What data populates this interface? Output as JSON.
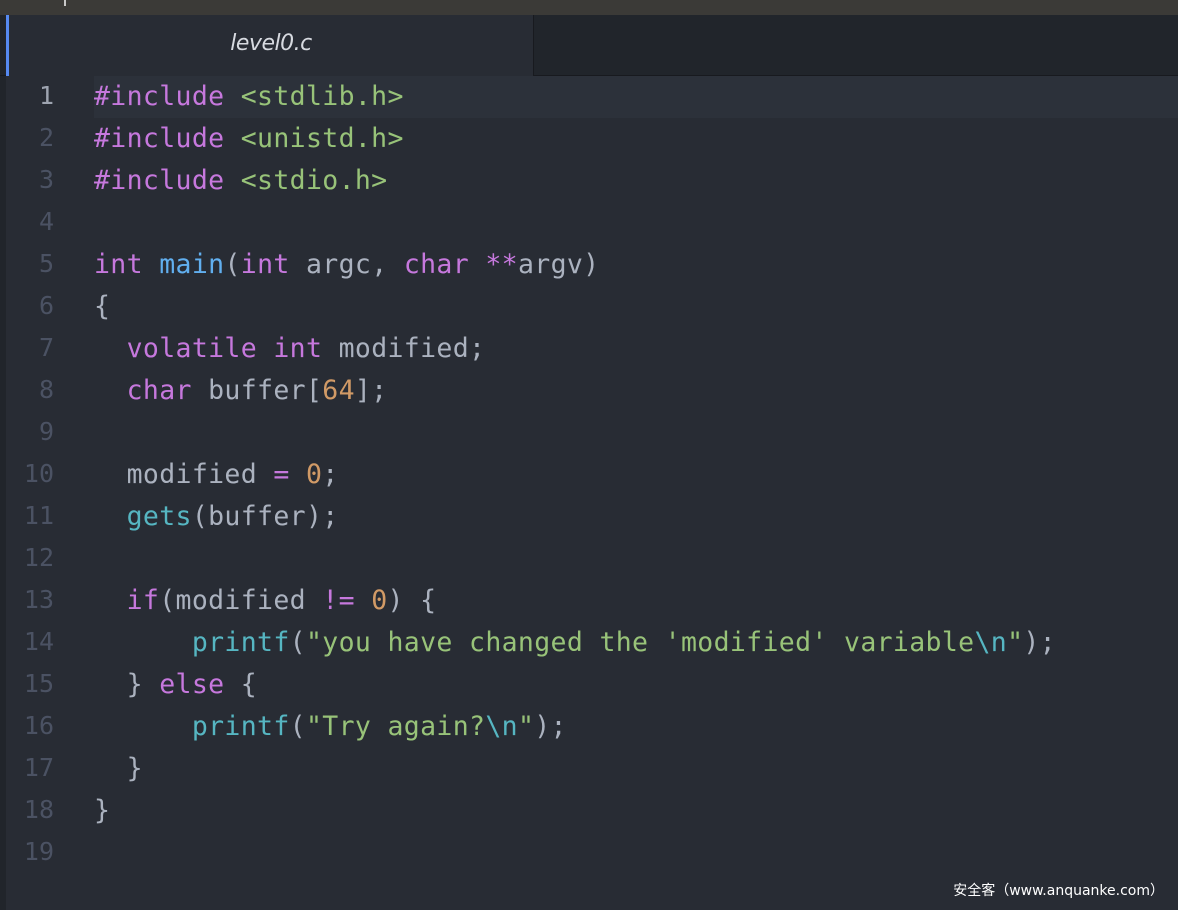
{
  "tab": {
    "title": "level0.c"
  },
  "lines": [
    {
      "n": "1",
      "tokens": [
        [
          "t-kw",
          "#include"
        ],
        [
          "t-plain",
          " "
        ],
        [
          "t-str",
          "<stdlib.h>"
        ]
      ]
    },
    {
      "n": "2",
      "tokens": [
        [
          "t-kw",
          "#include"
        ],
        [
          "t-plain",
          " "
        ],
        [
          "t-str",
          "<unistd.h>"
        ]
      ]
    },
    {
      "n": "3",
      "tokens": [
        [
          "t-kw",
          "#include"
        ],
        [
          "t-plain",
          " "
        ],
        [
          "t-str",
          "<stdio.h>"
        ]
      ]
    },
    {
      "n": "4",
      "tokens": []
    },
    {
      "n": "5",
      "tokens": [
        [
          "t-kw",
          "int"
        ],
        [
          "t-plain",
          " "
        ],
        [
          "t-fn",
          "main"
        ],
        [
          "t-plain",
          "("
        ],
        [
          "t-kw",
          "int"
        ],
        [
          "t-plain",
          " argc, "
        ],
        [
          "t-kw",
          "char"
        ],
        [
          "t-plain",
          " "
        ],
        [
          "t-op",
          "**"
        ],
        [
          "t-plain",
          "argv)"
        ]
      ]
    },
    {
      "n": "6",
      "tokens": [
        [
          "t-plain",
          "{"
        ]
      ]
    },
    {
      "n": "7",
      "tokens": [
        [
          "t-plain",
          "  "
        ],
        [
          "t-kw",
          "volatile"
        ],
        [
          "t-plain",
          " "
        ],
        [
          "t-kw",
          "int"
        ],
        [
          "t-plain",
          " modified;"
        ]
      ]
    },
    {
      "n": "8",
      "tokens": [
        [
          "t-plain",
          "  "
        ],
        [
          "t-kw",
          "char"
        ],
        [
          "t-plain",
          " buffer["
        ],
        [
          "t-num",
          "64"
        ],
        [
          "t-plain",
          "];"
        ]
      ]
    },
    {
      "n": "9",
      "tokens": []
    },
    {
      "n": "10",
      "tokens": [
        [
          "t-plain",
          "  modified "
        ],
        [
          "t-op",
          "="
        ],
        [
          "t-plain",
          " "
        ],
        [
          "t-num",
          "0"
        ],
        [
          "t-plain",
          ";"
        ]
      ]
    },
    {
      "n": "11",
      "tokens": [
        [
          "t-plain",
          "  "
        ],
        [
          "t-call",
          "gets"
        ],
        [
          "t-plain",
          "(buffer);"
        ]
      ]
    },
    {
      "n": "12",
      "tokens": []
    },
    {
      "n": "13",
      "tokens": [
        [
          "t-plain",
          "  "
        ],
        [
          "t-kw",
          "if"
        ],
        [
          "t-plain",
          "(modified "
        ],
        [
          "t-op",
          "!="
        ],
        [
          "t-plain",
          " "
        ],
        [
          "t-num",
          "0"
        ],
        [
          "t-plain",
          ") {"
        ]
      ]
    },
    {
      "n": "14",
      "tokens": [
        [
          "t-plain",
          "      "
        ],
        [
          "t-call",
          "printf"
        ],
        [
          "t-plain",
          "("
        ],
        [
          "t-str",
          "\"you have changed the 'modified' variable"
        ],
        [
          "t-esc",
          "\\n"
        ],
        [
          "t-str",
          "\""
        ],
        [
          "t-plain",
          ");"
        ]
      ]
    },
    {
      "n": "15",
      "tokens": [
        [
          "t-plain",
          "  } "
        ],
        [
          "t-kw",
          "else"
        ],
        [
          "t-plain",
          " {"
        ]
      ]
    },
    {
      "n": "16",
      "tokens": [
        [
          "t-plain",
          "      "
        ],
        [
          "t-call",
          "printf"
        ],
        [
          "t-plain",
          "("
        ],
        [
          "t-str",
          "\"Try again?"
        ],
        [
          "t-esc",
          "\\n"
        ],
        [
          "t-str",
          "\""
        ],
        [
          "t-plain",
          ");"
        ]
      ]
    },
    {
      "n": "17",
      "tokens": [
        [
          "t-plain",
          "  }"
        ]
      ]
    },
    {
      "n": "18",
      "tokens": [
        [
          "t-plain",
          "}"
        ]
      ]
    },
    {
      "n": "19",
      "tokens": []
    }
  ],
  "watermark": "安全客（www.anquanke.com）",
  "colors": {
    "background": "#282c34",
    "tab_accent": "#568af2",
    "keyword": "#c678dd",
    "string": "#98c379",
    "function": "#61afef",
    "number": "#d19a66",
    "escape": "#56b6c2"
  }
}
